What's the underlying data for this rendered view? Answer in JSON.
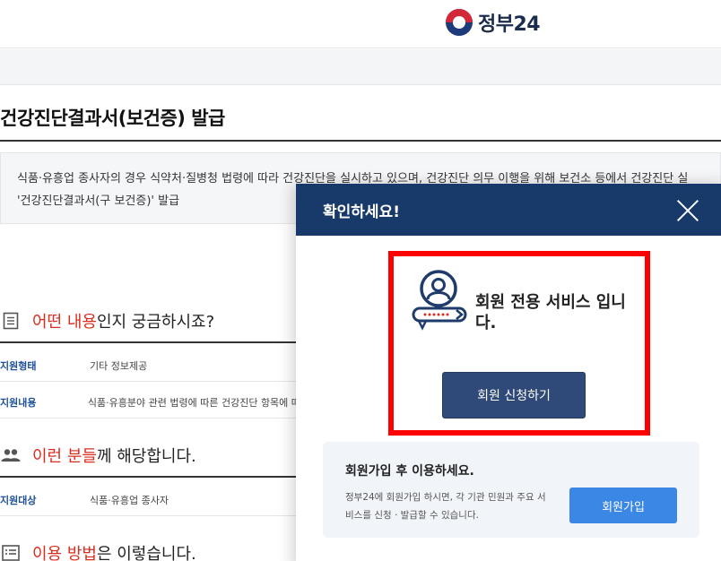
{
  "header": {
    "logo_text": "정부24"
  },
  "page": {
    "title": "건강진단결과서(보건증) 발급"
  },
  "notice": {
    "line1": "식품·유흥업 종사자의 경우 식약처·질병청 법령에 따라 건강진단을 실시하고 있으며, 건강진단 의무 이행을 위해 보건소 등에서 건강진단 실",
    "line2": "'건강진단결과서(구 보건증)' 발급"
  },
  "sections": {
    "what": {
      "highlight": "어떤 내용",
      "rest": "인지 궁금하시죠?",
      "icon": "document-icon"
    },
    "who": {
      "highlight": "이런 분들",
      "rest": "께 해당합니다.",
      "icon": "people-icon"
    },
    "how": {
      "highlight": "이용 방법",
      "rest": "은 이렇습니다.",
      "icon": "list-icon"
    }
  },
  "info_rows": [
    {
      "key": "지원형태",
      "value": "기타  정보제공"
    },
    {
      "key": "지원내용",
      "value": "식품·유흥분야 관련 법령에 따른 건강진단 항목에 따"
    }
  ],
  "target_rows": [
    {
      "key": "지원대상",
      "value": "식품·유흥업 종사자"
    }
  ],
  "modal": {
    "title": "확인하세요!",
    "member_message": "회원 전용 서비스 입니다.",
    "apply_button": "회원 신청하기",
    "join_title": "회원가입 후 이용하세요.",
    "join_desc": "정부24에 회원가입 하시면, 각 기관 민원과 주요 서비스를 신청 · 발급할 수 있습니다.",
    "join_button": "회원가입"
  },
  "colors": {
    "navy": "#173a6b",
    "highlight_red": "#d92d20",
    "box_red": "#ff0000",
    "join_blue": "#3b87e6"
  }
}
